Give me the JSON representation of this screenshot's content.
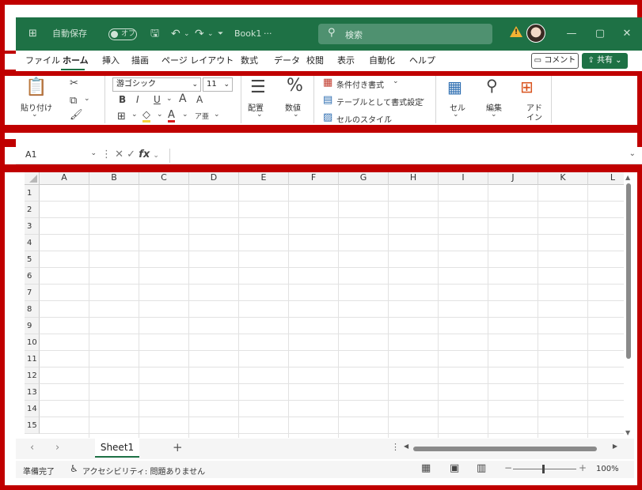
{
  "titlebar": {
    "app_icon": "excel-icon",
    "autosave_label": "自動保存",
    "autosave_state": "オフ",
    "save_icon": "save-icon",
    "undo_icon": "undo-icon",
    "redo_icon": "redo-icon",
    "customize_icon": "customize-qat-icon",
    "document_name": "Book1",
    "document_suffix": "···",
    "search_placeholder": "検索",
    "minimize_glyph": "—",
    "restore_glyph": "▢",
    "close_glyph": "✕",
    "colors": {
      "bar": "#1e7145"
    }
  },
  "tabs": [
    "ファイル",
    "ホーム",
    "挿入",
    "描画",
    "ページ レイアウト",
    "数式",
    "データ",
    "校閲",
    "表示",
    "自動化",
    "ヘルプ"
  ],
  "tab_comment": "コメント",
  "tab_share": "共有",
  "ribbon": {
    "paste_label": "貼り付け",
    "font_name": "游ゴシック",
    "font_size": "11",
    "bold": "B",
    "italic": "I",
    "underline": "U",
    "grow_font": "A",
    "shrink_font": "A",
    "align_label": "配置",
    "number_label": "数値",
    "conditional_format": "条件付き書式",
    "format_as_table": "テーブルとして書式設定",
    "cell_styles": "セルのスタイル",
    "cells_label": "セル",
    "edit_label": "編集",
    "addins_label_1": "アド",
    "addins_label_2": "イン",
    "percent_glyph": "%"
  },
  "formula_bar": {
    "name_box": "A1",
    "fx": "fx",
    "value": ""
  },
  "grid": {
    "columns": [
      "A",
      "B",
      "C",
      "D",
      "E",
      "F",
      "G",
      "H",
      "I",
      "J",
      "K",
      "L"
    ],
    "rows": [
      "1",
      "2",
      "3",
      "4",
      "5",
      "6",
      "7",
      "8",
      "9",
      "10",
      "11",
      "12",
      "13",
      "14",
      "15"
    ]
  },
  "sheets": {
    "active": "Sheet1",
    "add": "+"
  },
  "statusbar": {
    "ready": "準備完了",
    "accessibility": "アクセシビリティ: 問題ありません",
    "zoom": "100%"
  }
}
